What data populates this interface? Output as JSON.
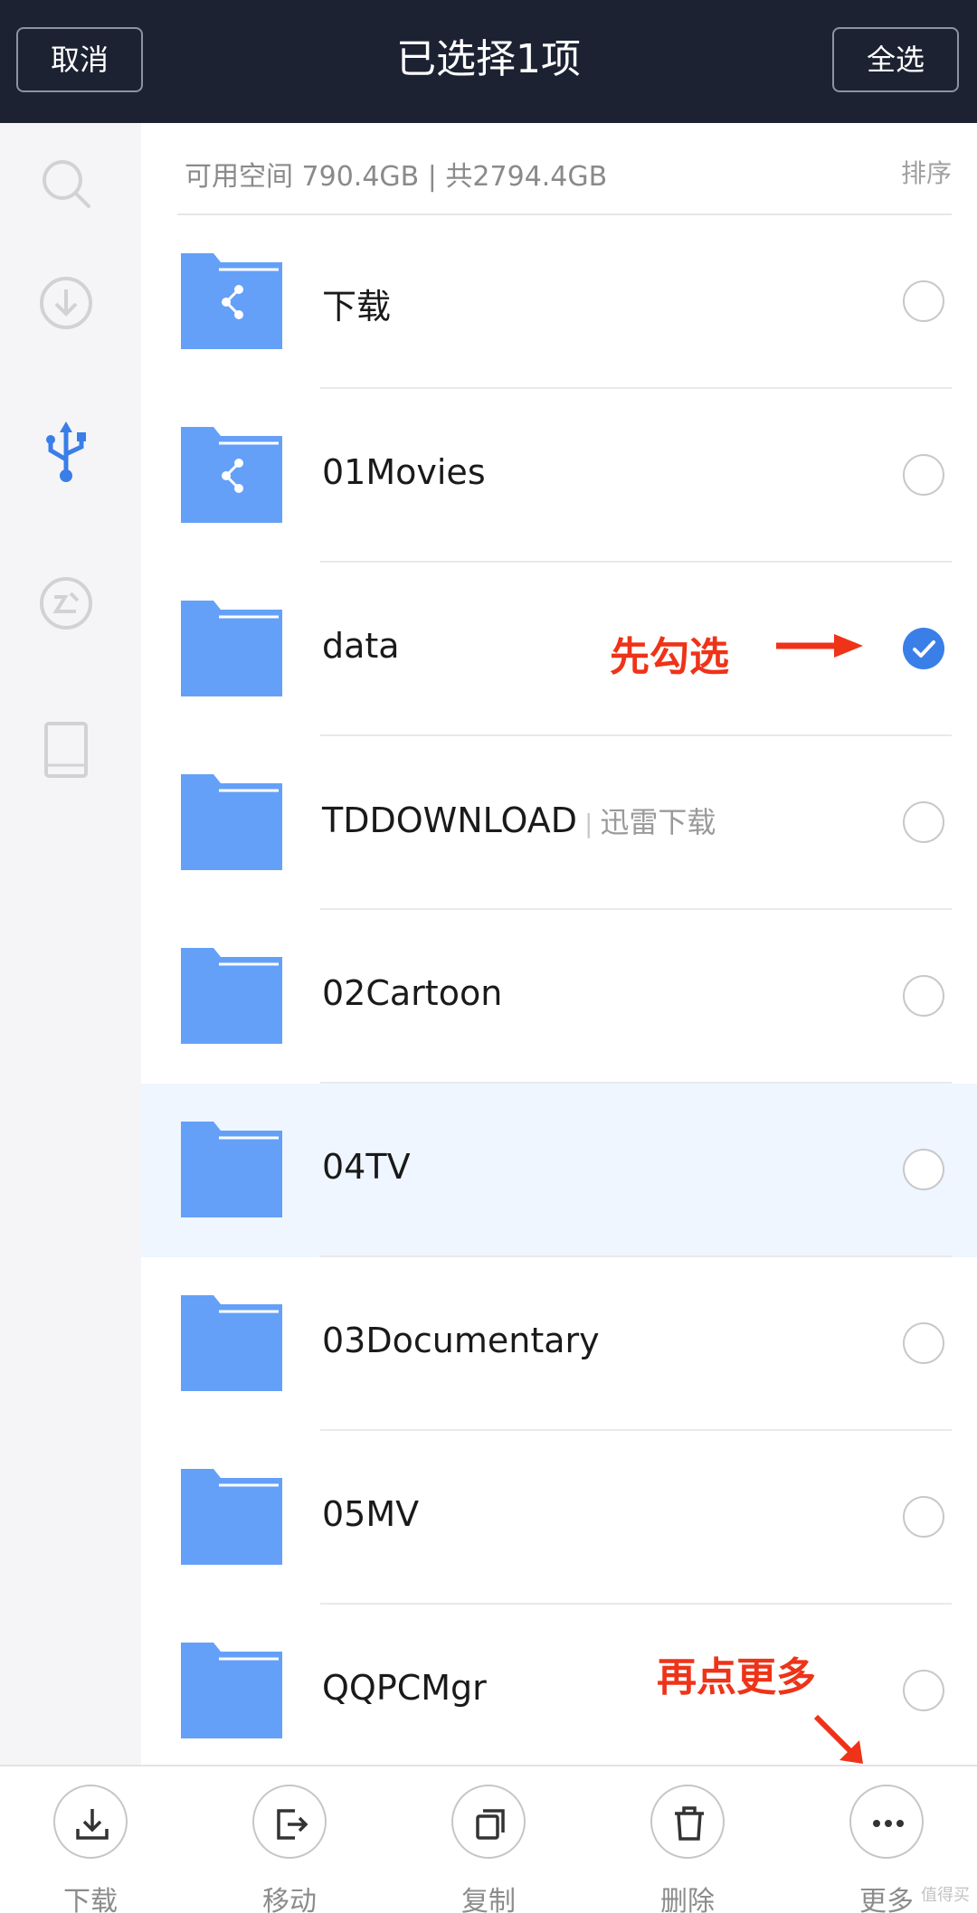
{
  "header": {
    "cancel_label": "取消",
    "title": "已选择1项",
    "select_all_label": "全选"
  },
  "sidebar": {
    "items": [
      {
        "icon": "search-icon",
        "active": false
      },
      {
        "icon": "download-icon",
        "active": false
      },
      {
        "icon": "usb-icon",
        "active": true
      },
      {
        "icon": "cast-icon",
        "active": false
      },
      {
        "icon": "tablet-icon",
        "active": false
      }
    ]
  },
  "storage": {
    "info": "可用空间 790.4GB | 共2794.4GB",
    "sort_label": "排序"
  },
  "files": [
    {
      "name": "下载",
      "shared": true,
      "selected": false
    },
    {
      "name": "01Movies",
      "shared": true,
      "selected": false
    },
    {
      "name": "data",
      "shared": false,
      "selected": true
    },
    {
      "name": "TDDOWNLOAD",
      "subtitle": "迅雷下载",
      "shared": false,
      "selected": false
    },
    {
      "name": "02Cartoon",
      "shared": false,
      "selected": false
    },
    {
      "name": "04TV",
      "shared": false,
      "selected": false,
      "highlighted": true
    },
    {
      "name": "03Documentary",
      "shared": false,
      "selected": false
    },
    {
      "name": "05MV",
      "shared": false,
      "selected": false
    },
    {
      "name": "QQPCMgr",
      "shared": false,
      "selected": false
    }
  ],
  "annotations": {
    "first": "先勾选",
    "second": "再点更多"
  },
  "toolbar": [
    {
      "label": "下载",
      "icon": "download-tray-icon"
    },
    {
      "label": "移动",
      "icon": "move-icon"
    },
    {
      "label": "复制",
      "icon": "copy-icon"
    },
    {
      "label": "删除",
      "icon": "trash-icon"
    },
    {
      "label": "更多",
      "icon": "more-icon"
    }
  ],
  "watermark": "值得买",
  "colors": {
    "topbar": "#1c2232",
    "folder": "#64a0f8",
    "accent": "#3a7ee8",
    "annotation": "#ee3319"
  }
}
